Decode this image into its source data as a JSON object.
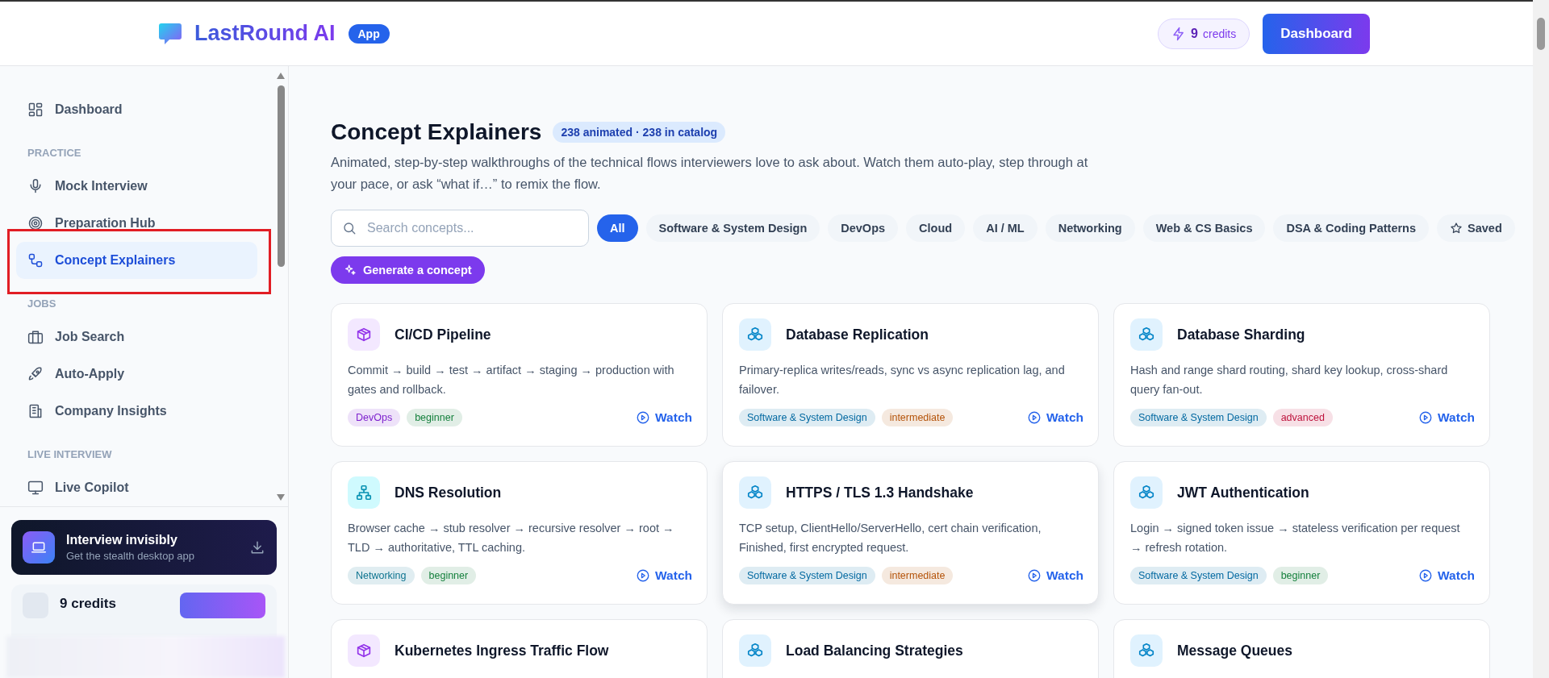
{
  "header": {
    "brand": "LastRound AI",
    "badge": "App",
    "credits": {
      "count": "9",
      "label": "credits"
    },
    "button": "Dashboard"
  },
  "sidebar": {
    "sections": [
      {
        "items": [
          {
            "label": "Dashboard",
            "selected": false,
            "highlighted": false
          }
        ]
      },
      {
        "heading": "PRACTICE",
        "items": [
          {
            "label": "Mock Interview",
            "selected": false,
            "highlighted": false
          },
          {
            "label": "Preparation Hub",
            "selected": false,
            "highlighted": false
          },
          {
            "label": "Concept Explainers",
            "selected": true,
            "highlighted": true
          }
        ]
      },
      {
        "heading": "JOBS",
        "items": [
          {
            "label": "Job Search",
            "selected": false,
            "highlighted": false
          },
          {
            "label": "Auto-Apply",
            "selected": false,
            "highlighted": false
          },
          {
            "label": "Company Insights",
            "selected": false,
            "highlighted": false
          }
        ]
      },
      {
        "heading": "LIVE INTERVIEW",
        "items": [
          {
            "label": "Live Copilot",
            "selected": false,
            "highlighted": false
          }
        ]
      }
    ],
    "promo": {
      "title": "Interview invisibly",
      "subtitle": "Get the stealth desktop app"
    },
    "credits": {
      "label": "9 credits"
    }
  },
  "main": {
    "title": "Concept Explainers",
    "count_badge": "238 animated · 238 in catalog",
    "description": "Animated, step-by-step walkthroughs of the technical flows interviewers love to ask about. Watch them auto-play, step through at your pace, or ask “what if…” to remix the flow.",
    "search": {
      "placeholder": "Search concepts..."
    },
    "filters": [
      {
        "label": "All",
        "kind": "filter",
        "selected": true
      },
      {
        "label": "Software & System Design",
        "kind": "filter",
        "selected": false
      },
      {
        "label": "DevOps",
        "kind": "filter",
        "selected": false
      },
      {
        "label": "Cloud",
        "kind": "filter",
        "selected": false
      },
      {
        "label": "AI / ML",
        "kind": "filter",
        "selected": false
      },
      {
        "label": "Networking",
        "kind": "filter",
        "selected": false
      },
      {
        "label": "Web & CS Basics",
        "kind": "filter",
        "selected": false
      },
      {
        "label": "DSA & Coding Patterns",
        "kind": "filter",
        "selected": false
      },
      {
        "label": "Saved",
        "kind": "saved",
        "selected": false
      }
    ],
    "generate_button": "Generate a concept",
    "cards": [
      {
        "title": "CI/CD Pipeline",
        "hovered": false,
        "description": "Commit → build → test → artifact → staging → production with gates and rollback.",
        "tags": [
          {
            "label": "DevOps",
            "color": "#7e22ce"
          },
          {
            "label": "beginner",
            "color": "#15803d"
          }
        ],
        "action": "Watch"
      },
      {
        "title": "Database Replication",
        "hovered": false,
        "description": "Primary-replica writes/reads, sync vs async replication lag, and failover.",
        "tags": [
          {
            "label": "Software & System Design",
            "color": "#0369a1"
          },
          {
            "label": "intermediate",
            "color": "#b45309"
          }
        ],
        "action": "Watch"
      },
      {
        "title": "Database Sharding",
        "hovered": false,
        "description": "Hash and range shard routing, shard key lookup, cross-shard query fan-out.",
        "tags": [
          {
            "label": "Software & System Design",
            "color": "#0369a1"
          },
          {
            "label": "advanced",
            "color": "#be123c"
          }
        ],
        "action": "Watch"
      },
      {
        "title": "DNS Resolution",
        "hovered": false,
        "description": "Browser cache → stub resolver → recursive resolver → root → TLD → authoritative, TTL caching.",
        "tags": [
          {
            "label": "Networking",
            "color": "#0e7490"
          },
          {
            "label": "beginner",
            "color": "#15803d"
          }
        ],
        "action": "Watch"
      },
      {
        "title": "HTTPS / TLS 1.3 Handshake",
        "hovered": true,
        "description": "TCP setup, ClientHello/ServerHello, cert chain verification, Finished, first encrypted request.",
        "tags": [
          {
            "label": "Software & System Design",
            "color": "#0369a1"
          },
          {
            "label": "intermediate",
            "color": "#b45309"
          }
        ],
        "action": "Watch"
      },
      {
        "title": "JWT Authentication",
        "hovered": false,
        "description": "Login → signed token issue → stateless verification per request → refresh rotation.",
        "tags": [
          {
            "label": "Software & System Design",
            "color": "#0369a1"
          },
          {
            "label": "beginner",
            "color": "#15803d"
          }
        ],
        "action": "Watch"
      },
      {
        "title": "Kubernetes Ingress Traffic Flow",
        "hovered": false
      },
      {
        "title": "Load Balancing Strategies",
        "hovered": false
      },
      {
        "title": "Message Queues",
        "hovered": false
      }
    ]
  }
}
